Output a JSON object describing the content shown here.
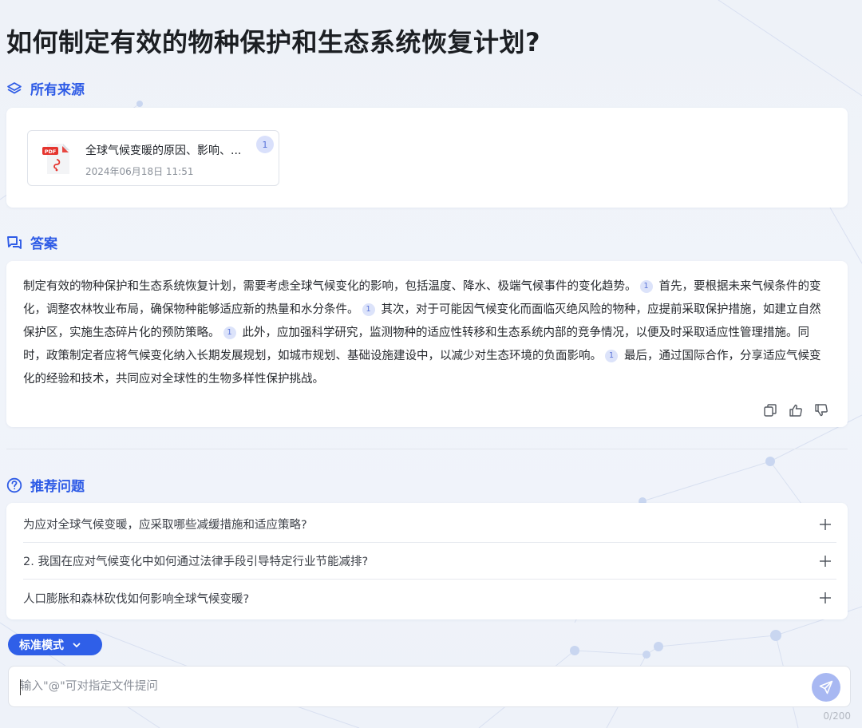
{
  "page": {
    "title": "如何制定有效的物种保护和生态系统恢复计划?"
  },
  "sources": {
    "heading": "所有来源",
    "items": [
      {
        "name": "全球气候变暖的原因、影响、...",
        "date": "2024年06月18日 11:51",
        "badge": "1",
        "icon_label": "PDF"
      }
    ]
  },
  "answer": {
    "heading": "答案",
    "segments": [
      {
        "text": "制定有效的物种保护和生态系统恢复计划，需要考虑全球气候变化的影响，包括温度、降水、极端气候事件的变化趋势。",
        "cite": "1"
      },
      {
        "text": "首先，要根据未来气候条件的变化，调整农林牧业布局，确保物种能够适应新的热量和水分条件。",
        "cite": "1"
      },
      {
        "text": "其次，对于可能因气候变化而面临灭绝风险的物种，应提前采取保护措施，如建立自然保护区，实施生态碎片化的预防策略。",
        "cite": "1"
      },
      {
        "text": "此外，应加强科学研究，监测物种的适应性转移和生态系统内部的竞争情况，以便及时采取适应性管理措施。同时，政策制定者应将气候变化纳入长期发展规划，如城市规划、基础设施建设中，以减少对生态环境的负面影响。",
        "cite": "1"
      },
      {
        "text": "最后，通过国际合作，分享适应气候变化的经验和技术，共同应对全球性的生物多样性保护挑战。",
        "cite": ""
      }
    ]
  },
  "recommended": {
    "heading": "推荐问题",
    "items": [
      "为应对全球气候变暖，应采取哪些减缓措施和适应策略?",
      "2. 我国在应对气候变化中如何通过法律手段引导特定行业节能减排?",
      "人口膨胀和森林砍伐如何影响全球气候变暖?"
    ]
  },
  "mode": {
    "label": "标准模式"
  },
  "input": {
    "placeholder": "输入\"@\"可对指定文件提问",
    "value": "",
    "counter": "0/200"
  },
  "colors": {
    "accent": "#2e5be6",
    "send_button": "#a8b8f2",
    "citation_bg": "#dce3fa"
  }
}
